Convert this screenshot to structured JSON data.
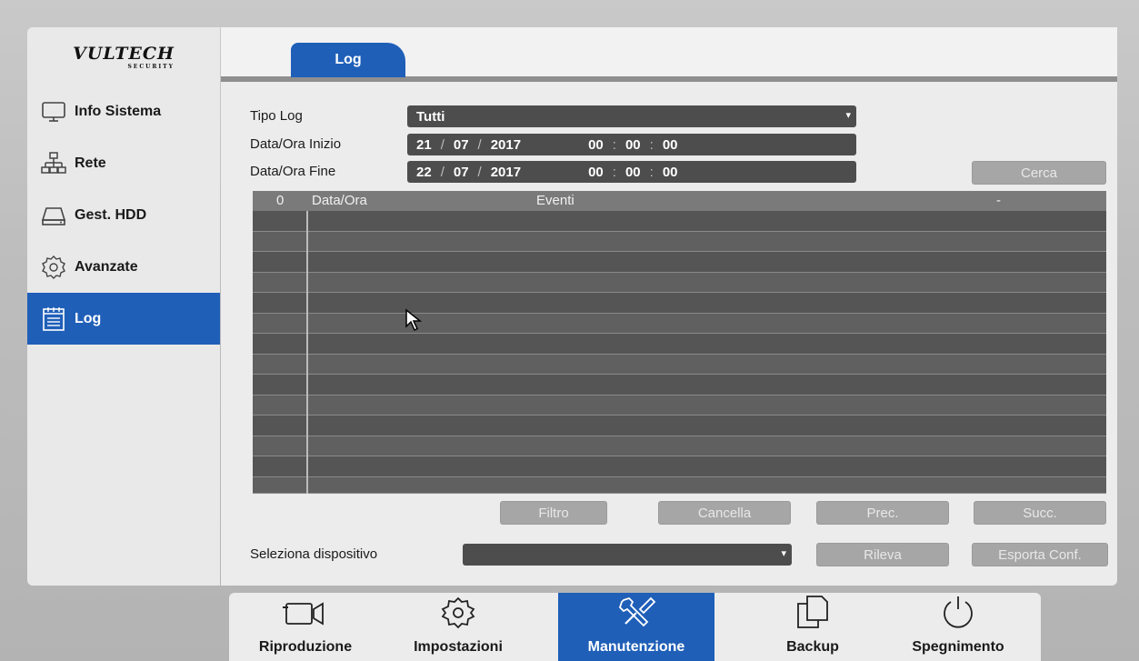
{
  "brand": {
    "logo_text": "VULTECH",
    "logo_sub": "SECURITY"
  },
  "sidebar": {
    "items": [
      {
        "label": "Info Sistema",
        "icon": "monitor-icon",
        "active": false
      },
      {
        "label": "Rete",
        "icon": "network-icon",
        "active": false
      },
      {
        "label": "Gest. HDD",
        "icon": "hdd-icon",
        "active": false
      },
      {
        "label": "Avanzate",
        "icon": "gear-icon",
        "active": false
      },
      {
        "label": "Log",
        "icon": "log-icon",
        "active": true
      }
    ]
  },
  "tabs": [
    {
      "label": "Log",
      "active": true
    }
  ],
  "form": {
    "type_label": "Tipo Log",
    "type_value": "Tutti",
    "start_label": "Data/Ora Inizio",
    "start": {
      "day": "21",
      "month": "07",
      "year": "2017",
      "hh": "00",
      "mm": "00",
      "ss": "00"
    },
    "end_label": "Data/Ora Fine",
    "end": {
      "day": "22",
      "month": "07",
      "year": "2017",
      "hh": "00",
      "mm": "00",
      "ss": "00"
    },
    "date_sep": "/",
    "time_sep": ":",
    "search_button": "Cerca"
  },
  "table": {
    "headers": {
      "index": "0",
      "datetime": "Data/Ora",
      "events": "Eventi",
      "extra": "-"
    },
    "rows": []
  },
  "actions": {
    "filter": "Filtro",
    "delete": "Cancella",
    "prev": "Prec.",
    "next": "Succ."
  },
  "device": {
    "label": "Seleziona dispositivo",
    "value": "",
    "detect_button": "Rileva",
    "export_button": "Esporta Conf."
  },
  "toolbar": {
    "items": [
      {
        "label": "Riproduzione",
        "icon": "camera-icon",
        "active": false
      },
      {
        "label": "Impostazioni",
        "icon": "settings-icon",
        "active": false
      },
      {
        "label": "Manutenzione",
        "icon": "tools-icon",
        "active": true
      },
      {
        "label": "Backup",
        "icon": "copy-icon",
        "active": false
      },
      {
        "label": "Spegnimento",
        "icon": "power-icon",
        "active": false
      }
    ]
  },
  "colors": {
    "accent": "#1f5fb8",
    "field_bg": "#4d4d4d",
    "table_bg": "#5c5c5c"
  }
}
